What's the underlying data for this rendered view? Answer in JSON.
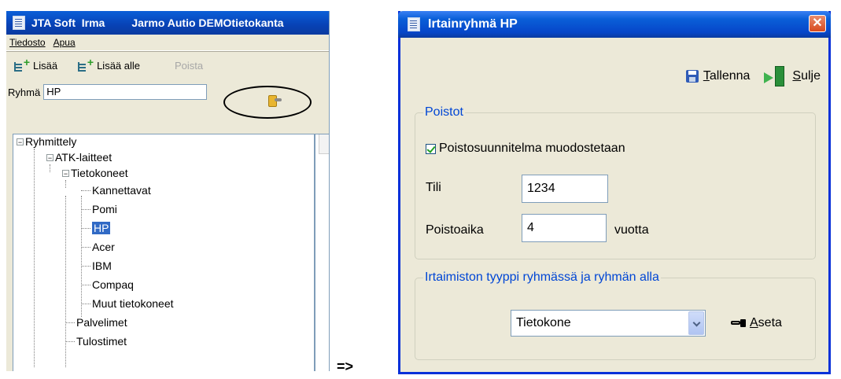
{
  "left_window": {
    "title": "JTA Soft  Irma",
    "title2": "Jarmo Autio DEMOtietokanta",
    "menu": [
      "Tiedosto",
      "Apua"
    ],
    "toolbar": {
      "add": "Lisää",
      "add_below": "Lisää alle",
      "remove": "Poista"
    },
    "group_label": "Ryhmä",
    "group_value": "HP",
    "tree": [
      {
        "label": "Ryhmittely"
      },
      {
        "label": "ATK-laitteet"
      },
      {
        "label": "Tietokoneet"
      },
      {
        "label": "Kannettavat"
      },
      {
        "label": "Pomi"
      },
      {
        "label": "HP"
      },
      {
        "label": "Acer"
      },
      {
        "label": "IBM"
      },
      {
        "label": "Compaq"
      },
      {
        "label": "Muut tietokoneet"
      },
      {
        "label": "Palvelimet"
      },
      {
        "label": "Tulostimet"
      }
    ]
  },
  "arrow": "=>",
  "dialog": {
    "title": "Irtainryhmä HP",
    "close": "✕",
    "save_label": "Tallenna",
    "save_prefix": "T",
    "save_rest": "allenna",
    "close_label_prefix": "S",
    "close_label_rest": "ulje",
    "depreciation": {
      "legend": "Poistot",
      "checkbox_label": "Poistosuunnitelma muodostetaan",
      "checked": true,
      "account_label": "Tili",
      "account_value": "1234",
      "period_label": "Poistoaika",
      "period_value": "4",
      "period_unit": "vuotta"
    },
    "asset_type": {
      "legend": "Irtaimiston tyyppi ryhmässä ja ryhmän alla",
      "selected": "Tietokone",
      "apply_prefix": "A",
      "apply_rest": "seta"
    }
  }
}
